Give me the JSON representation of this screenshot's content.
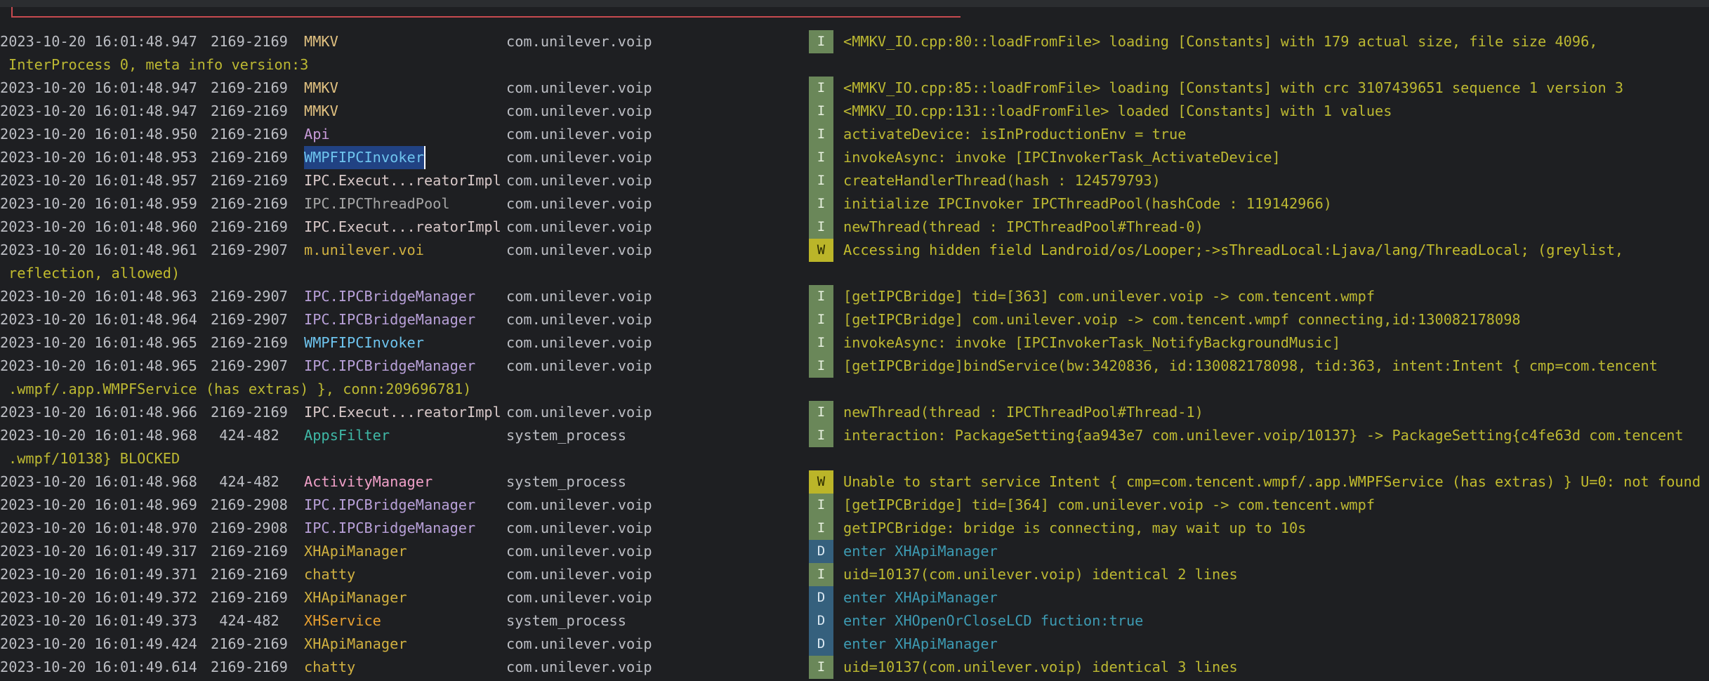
{
  "colors": {
    "background": "#1e1f22",
    "info_badge": "#6a8759",
    "warn_badge": "#bbb529",
    "debug_badge": "#35607d",
    "info_text": "#bcb832",
    "debug_text": "#3d9bb3"
  },
  "rows": [
    {
      "date": "2023-10-20 16:01:48.947",
      "pid": "2169-2169",
      "tag": "MMKV",
      "tag_color": "#e0c080",
      "pkg": "com.unilever.voip",
      "level": "I",
      "msg": "<MMKV_IO.cpp:80::loadFromFile> loading [Constants] with 179 actual size, file size 4096,",
      "cont": "InterProcess 0, meta info version:3"
    },
    {
      "date": "2023-10-20 16:01:48.947",
      "pid": "2169-2169",
      "tag": "MMKV",
      "tag_color": "#e0c080",
      "pkg": "com.unilever.voip",
      "level": "I",
      "msg": "<MMKV_IO.cpp:85::loadFromFile> loading [Constants] with crc 3107439651 sequence 1 version 3",
      "cont": ""
    },
    {
      "date": "2023-10-20 16:01:48.947",
      "pid": "2169-2169",
      "tag": "MMKV",
      "tag_color": "#e0c080",
      "pkg": "com.unilever.voip",
      "level": "I",
      "msg": "<MMKV_IO.cpp:131::loadFromFile> loaded [Constants] with 1 values",
      "cont": ""
    },
    {
      "date": "2023-10-20 16:01:48.950",
      "pid": "2169-2169",
      "tag": "Api",
      "tag_color": "#c79ad8",
      "pkg": "com.unilever.voip",
      "level": "I",
      "msg": "activateDevice: isInProductionEnv = true",
      "cont": ""
    },
    {
      "date": "2023-10-20 16:01:48.953",
      "pid": "2169-2169",
      "tag": "WMPFIPCInvoker",
      "tag_color": "#6ec4ee",
      "pkg": "com.unilever.voip",
      "level": "I",
      "msg": "invokeAsync: invoke [IPCInvokerTask_ActivateDevice]",
      "cont": "",
      "selected": true
    },
    {
      "date": "2023-10-20 16:01:48.957",
      "pid": "2169-2169",
      "tag": "IPC.Execut...reatorImpl",
      "tag_color": "#d8c8c8",
      "pkg": "com.unilever.voip",
      "level": "I",
      "msg": "createHandlerThread(hash : 124579793)",
      "cont": ""
    },
    {
      "date": "2023-10-20 16:01:48.959",
      "pid": "2169-2169",
      "tag": "IPC.IPCThreadPool",
      "tag_color": "#a6a6a6",
      "pkg": "com.unilever.voip",
      "level": "I",
      "msg": "initialize IPCInvoker IPCThreadPool(hashCode : 119142966)",
      "cont": ""
    },
    {
      "date": "2023-10-20 16:01:48.960",
      "pid": "2169-2169",
      "tag": "IPC.Execut...reatorImpl",
      "tag_color": "#d8c8c8",
      "pkg": "com.unilever.voip",
      "level": "I",
      "msg": "newThread(thread : IPCThreadPool#Thread-0)",
      "cont": ""
    },
    {
      "date": "2023-10-20 16:01:48.961",
      "pid": "2169-2907",
      "tag": "m.unilever.voi",
      "tag_color": "#d0b040",
      "pkg": "com.unilever.voip",
      "level": "W",
      "msg": "Accessing hidden field Landroid/os/Looper;->sThreadLocal:Ljava/lang/ThreadLocal; (greylist,",
      "cont": "reflection, allowed)"
    },
    {
      "date": "2023-10-20 16:01:48.963",
      "pid": "2169-2907",
      "tag": "IPC.IPCBridgeManager",
      "tag_color": "#b8a0d8",
      "pkg": "com.unilever.voip",
      "level": "I",
      "msg": "[getIPCBridge] tid=[363] com.unilever.voip -> com.tencent.wmpf",
      "cont": ""
    },
    {
      "date": "2023-10-20 16:01:48.964",
      "pid": "2169-2907",
      "tag": "IPC.IPCBridgeManager",
      "tag_color": "#b8a0d8",
      "pkg": "com.unilever.voip",
      "level": "I",
      "msg": "[getIPCBridge] com.unilever.voip -> com.tencent.wmpf connecting,id:130082178098",
      "cont": ""
    },
    {
      "date": "2023-10-20 16:01:48.965",
      "pid": "2169-2169",
      "tag": "WMPFIPCInvoker",
      "tag_color": "#6ec4ee",
      "pkg": "com.unilever.voip",
      "level": "I",
      "msg": "invokeAsync: invoke [IPCInvokerTask_NotifyBackgroundMusic]",
      "cont": ""
    },
    {
      "date": "2023-10-20 16:01:48.965",
      "pid": "2169-2907",
      "tag": "IPC.IPCBridgeManager",
      "tag_color": "#b8a0d8",
      "pkg": "com.unilever.voip",
      "level": "I",
      "msg": "[getIPCBridge]bindService(bw:3420836, id:130082178098, tid:363, intent:Intent { cmp=com.tencent",
      "cont": ".wmpf/.app.WMPFService (has extras) }, conn:209696781)"
    },
    {
      "date": "2023-10-20 16:01:48.966",
      "pid": "2169-2169",
      "tag": "IPC.Execut...reatorImpl",
      "tag_color": "#d8c8c8",
      "pkg": "com.unilever.voip",
      "level": "I",
      "msg": "newThread(thread : IPCThreadPool#Thread-1)",
      "cont": ""
    },
    {
      "date": "2023-10-20 16:01:48.968",
      "pid": " 424-482",
      "tag": "AppsFilter",
      "tag_color": "#3fb8a6",
      "pkg": "system_process",
      "level": "I",
      "msg": "interaction: PackageSetting{aa943e7 com.unilever.voip/10137} -> PackageSetting{c4fe63d com.tencent",
      "cont": ".wmpf/10138} BLOCKED"
    },
    {
      "date": "2023-10-20 16:01:48.968",
      "pid": " 424-482",
      "tag": "ActivityManager",
      "tag_color": "#f0a0c8",
      "pkg": "system_process",
      "level": "W",
      "msg": "Unable to start service Intent { cmp=com.tencent.wmpf/.app.WMPFService (has extras) } U=0: not found",
      "cont": ""
    },
    {
      "date": "2023-10-20 16:01:48.969",
      "pid": "2169-2908",
      "tag": "IPC.IPCBridgeManager",
      "tag_color": "#b8a0d8",
      "pkg": "com.unilever.voip",
      "level": "I",
      "msg": "[getIPCBridge] tid=[364] com.unilever.voip -> com.tencent.wmpf",
      "cont": ""
    },
    {
      "date": "2023-10-20 16:01:48.970",
      "pid": "2169-2908",
      "tag": "IPC.IPCBridgeManager",
      "tag_color": "#b8a0d8",
      "pkg": "com.unilever.voip",
      "level": "I",
      "msg": "getIPCBridge: bridge is connecting, may wait up to 10s",
      "cont": ""
    },
    {
      "date": "2023-10-20 16:01:49.317",
      "pid": "2169-2169",
      "tag": "XHApiManager",
      "tag_color": "#d0b040",
      "pkg": "com.unilever.voip",
      "level": "D",
      "msg": "enter XHApiManager",
      "cont": ""
    },
    {
      "date": "2023-10-20 16:01:49.371",
      "pid": "2169-2169",
      "tag": "chatty",
      "tag_color": "#d0b040",
      "pkg": "com.unilever.voip",
      "level": "I",
      "msg": "uid=10137(com.unilever.voip) identical 2 lines",
      "cont": ""
    },
    {
      "date": "2023-10-20 16:01:49.372",
      "pid": "2169-2169",
      "tag": "XHApiManager",
      "tag_color": "#d0b040",
      "pkg": "com.unilever.voip",
      "level": "D",
      "msg": "enter XHApiManager",
      "cont": ""
    },
    {
      "date": "2023-10-20 16:01:49.373",
      "pid": " 424-482",
      "tag": "XHService",
      "tag_color": "#e8a030",
      "pkg": "system_process",
      "level": "D",
      "msg": "enter XHOpenOrCloseLCD fuction:true",
      "cont": ""
    },
    {
      "date": "2023-10-20 16:01:49.424",
      "pid": "2169-2169",
      "tag": "XHApiManager",
      "tag_color": "#d0b040",
      "pkg": "com.unilever.voip",
      "level": "D",
      "msg": "enter XHApiManager",
      "cont": ""
    },
    {
      "date": "2023-10-20 16:01:49.614",
      "pid": "2169-2169",
      "tag": "chatty",
      "tag_color": "#d0b040",
      "pkg": "com.unilever.voip",
      "level": "I",
      "msg": "uid=10137(com.unilever.voip) identical 3 lines",
      "cont": ""
    }
  ]
}
